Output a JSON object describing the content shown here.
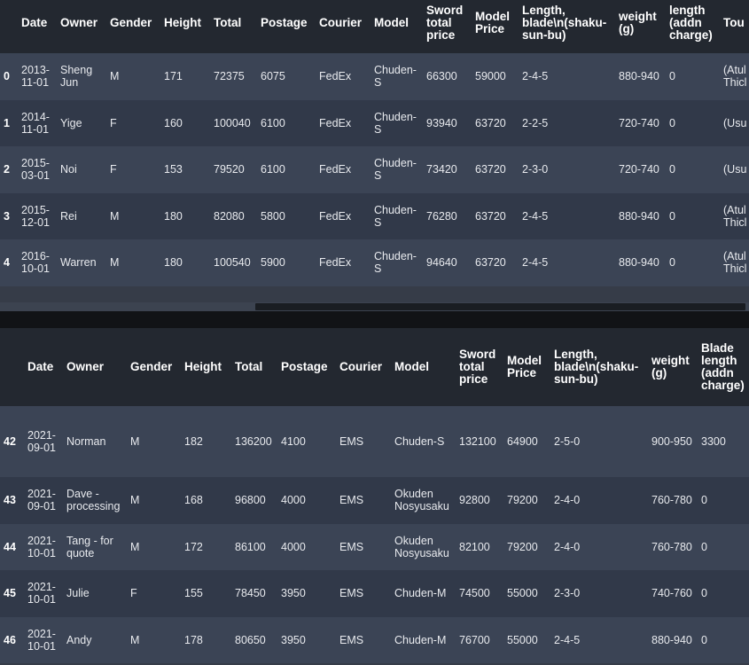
{
  "top_table": {
    "columns": [
      "",
      "Date",
      "Owner",
      "Gender",
      "Height",
      "Total",
      "Postage",
      "Courier",
      "Model",
      "Sword total price",
      "Model Price",
      "Length, blade\\n(shaku-sun-bu)",
      "weight (g)",
      "length (addn charge)",
      "Tou"
    ],
    "rows": [
      [
        "0",
        "2013-11-01",
        "Sheng Jun",
        "M",
        "171",
        "72375",
        "6075",
        "FedEx",
        "Chuden-S",
        "66300",
        "59000",
        "2-4-5",
        "880-940",
        "0",
        "(Atul usub Thicl"
      ],
      [
        "1",
        "2014-11-01",
        "Yige",
        "F",
        "160",
        "100040",
        "6100",
        "FedEx",
        "Chuden-S",
        "93940",
        "63720",
        "2-2-5",
        "720-740",
        "0",
        "(Usu Thin"
      ],
      [
        "2",
        "2015-03-01",
        "Noi",
        "F",
        "153",
        "79520",
        "6100",
        "FedEx",
        "Chuden-S",
        "73420",
        "63720",
        "2-3-0",
        "720-740",
        "0",
        "(Usu Thin"
      ],
      [
        "3",
        "2015-12-01",
        "Rei",
        "M",
        "180",
        "82080",
        "5800",
        "FedEx",
        "Chuden-S",
        "76280",
        "63720",
        "2-4-5",
        "880-940",
        "0",
        "(Atul usub Thicl"
      ],
      [
        "4",
        "2016-10-01",
        "Warren",
        "M",
        "180",
        "100540",
        "5900",
        "FedEx",
        "Chuden-S",
        "94640",
        "63720",
        "2-4-5",
        "880-940",
        "0",
        "(Atul usub Thicl"
      ]
    ]
  },
  "bottom_table": {
    "columns": [
      "",
      "Date",
      "Owner",
      "Gender",
      "Height",
      "Total",
      "Postage",
      "Courier",
      "Model",
      "Sword total price",
      "Model Price",
      "Length, blade\\n(shaku-sun-bu)",
      "weight (g)",
      "Blade length (addn charge)"
    ],
    "rows": [
      [
        "42",
        "2021-09-01",
        "Norman",
        "M",
        "182",
        "136200",
        "4100",
        "EMS",
        "Chuden-S",
        "132100",
        "64900",
        "2-5-0",
        "900-950",
        "3300"
      ],
      [
        "43",
        "2021-09-01",
        "Dave - processing",
        "M",
        "168",
        "96800",
        "4000",
        "EMS",
        "Okuden Nosyusaku",
        "92800",
        "79200",
        "2-4-0",
        "760-780",
        "0"
      ],
      [
        "44",
        "2021-10-01",
        "Tang - for quote",
        "M",
        "172",
        "86100",
        "4000",
        "EMS",
        "Okuden Nosyusaku",
        "82100",
        "79200",
        "2-4-0",
        "760-780",
        "0"
      ],
      [
        "45",
        "2021-10-01",
        "Julie",
        "F",
        "155",
        "78450",
        "3950",
        "EMS",
        "Chuden-M",
        "74500",
        "55000",
        "2-3-0",
        "740-760",
        "0"
      ],
      [
        "46",
        "2021-10-01",
        "Andy",
        "M",
        "178",
        "80650",
        "3950",
        "EMS",
        "Chuden-M",
        "76700",
        "55000",
        "2-4-5",
        "880-940",
        "0"
      ]
    ]
  },
  "scrollbar": {
    "position": 0.34
  }
}
